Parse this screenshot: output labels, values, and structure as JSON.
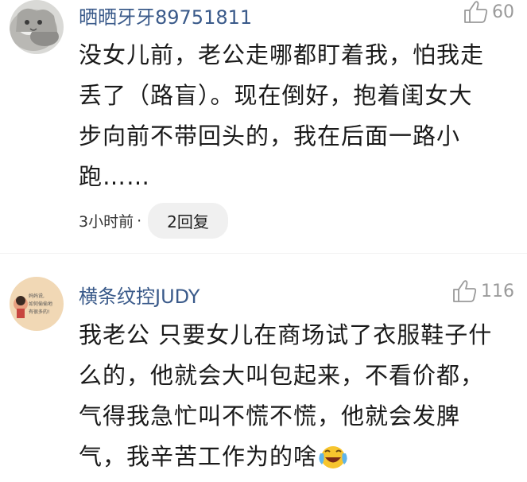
{
  "comments": [
    {
      "username": "晒晒牙牙89751811",
      "likes": "60",
      "lines": [
        "没女儿前，老公走哪都盯着我，怕我走",
        "丢了（路盲）。现在倒好，抱着闺女大",
        "步向前不带回头的，我在后面一路小",
        "跑……"
      ],
      "time": "3小时前",
      "separator": "·",
      "reply_label": "2回复",
      "avatar_icon": "cat-avatar"
    },
    {
      "username": "横条纹控JUDY",
      "likes": "116",
      "lines": [
        "我老公 只要女儿在商场试了衣服鞋子什",
        "么的，他就会大叫包起来，不看价都，",
        "气得我急忙叫不慌不慌，他就会发脾",
        "气，我辛苦工作为的啥"
      ],
      "emoji": "laughing-crying-emoji",
      "avatar_icon": "cartoon-girl-avatar",
      "avatar_note": [
        "妈妈说,",
        "如何偷偷地",
        "有很多的!"
      ]
    }
  ],
  "colors": {
    "username": "#3a5a8a",
    "text": "#1a1a1a",
    "muted": "#9a9a9a",
    "reply_bg": "#f0f0f0"
  }
}
